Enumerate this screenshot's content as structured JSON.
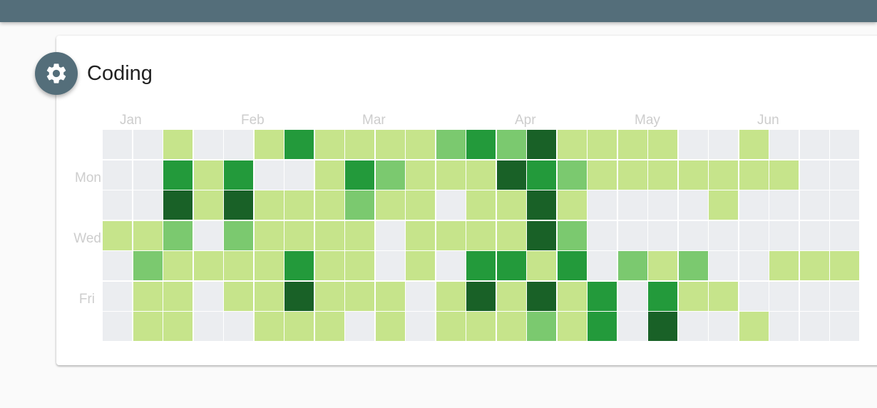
{
  "card": {
    "title": "Coding",
    "settings_icon": "gear-icon"
  },
  "colors": {
    "topbar": "#546e7a",
    "level0": "#ebedf0",
    "level1": "#c6e48b",
    "level2": "#7bc96f",
    "level3": "#239a3b",
    "level4": "#196127"
  },
  "months": [
    "Jan",
    "Feb",
    "Mar",
    "Apr",
    "May",
    "Jun"
  ],
  "days": [
    "Mon",
    "Wed",
    "Fri"
  ],
  "chart_data": {
    "type": "heatmap",
    "title": "",
    "rows": 7,
    "levels": [
      [
        0,
        0,
        1,
        0,
        0,
        1,
        3,
        1,
        1,
        1,
        1,
        2,
        3,
        2,
        4,
        1,
        1,
        1,
        1,
        0,
        0,
        1,
        0,
        0,
        0
      ],
      [
        0,
        0,
        3,
        1,
        3,
        0,
        0,
        1,
        3,
        2,
        1,
        1,
        1,
        4,
        3,
        2,
        1,
        1,
        1,
        1,
        1,
        1,
        1,
        0,
        0
      ],
      [
        0,
        0,
        4,
        1,
        4,
        1,
        1,
        1,
        2,
        1,
        1,
        0,
        1,
        1,
        4,
        1,
        0,
        0,
        0,
        0,
        1,
        0,
        0,
        0,
        0
      ],
      [
        1,
        1,
        2,
        0,
        2,
        1,
        1,
        1,
        1,
        0,
        1,
        1,
        1,
        1,
        4,
        2,
        0,
        0,
        0,
        0,
        0,
        0,
        0,
        0,
        0
      ],
      [
        0,
        2,
        1,
        1,
        1,
        1,
        3,
        1,
        1,
        0,
        1,
        0,
        3,
        3,
        1,
        3,
        0,
        2,
        1,
        2,
        0,
        0,
        1,
        1,
        1
      ],
      [
        0,
        1,
        1,
        0,
        1,
        1,
        4,
        1,
        1,
        1,
        0,
        1,
        4,
        1,
        4,
        1,
        3,
        0,
        3,
        1,
        1,
        0,
        0,
        0,
        0
      ],
      [
        0,
        1,
        1,
        0,
        0,
        1,
        1,
        1,
        0,
        1,
        0,
        1,
        1,
        1,
        2,
        1,
        3,
        0,
        4,
        0,
        0,
        1,
        0,
        0,
        0
      ]
    ]
  }
}
